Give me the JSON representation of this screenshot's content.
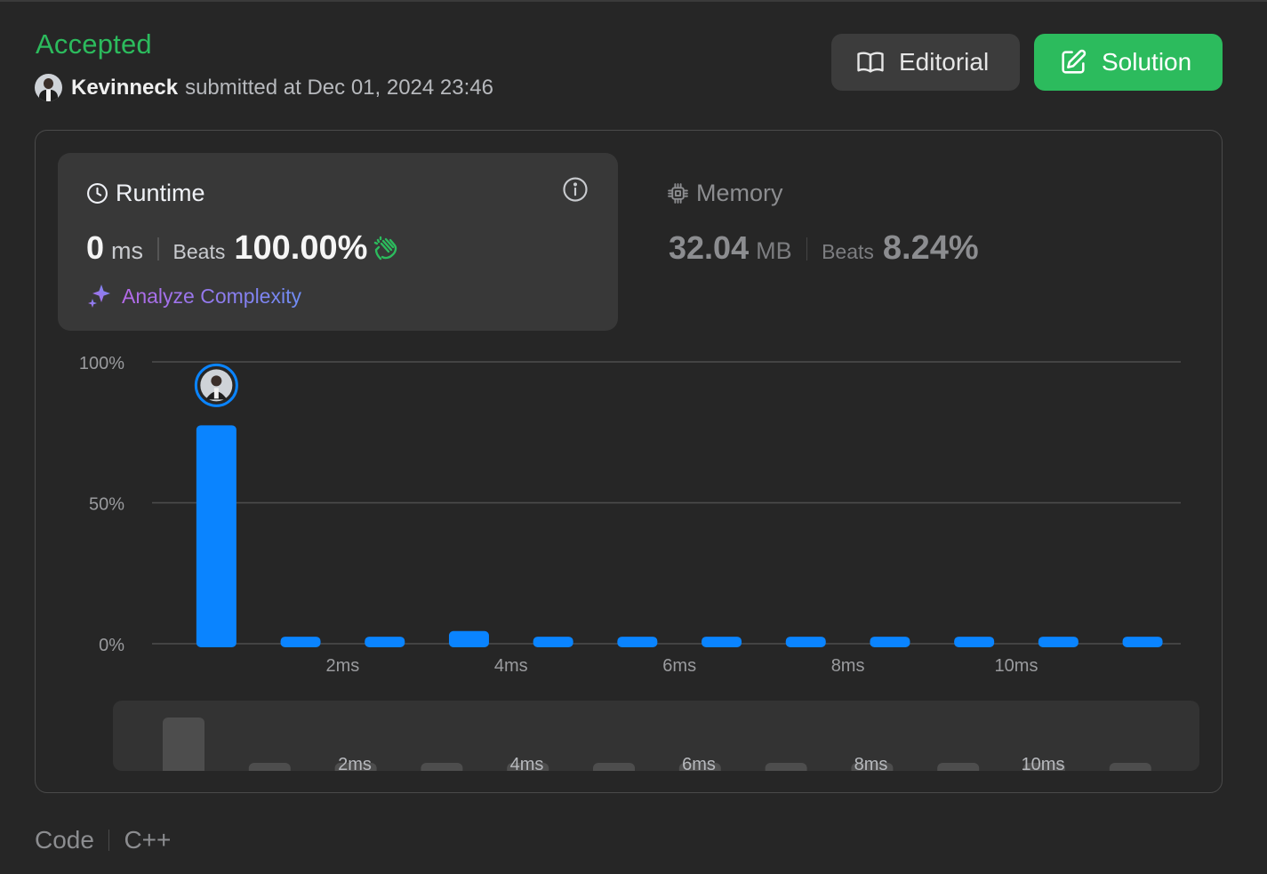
{
  "header": {
    "status": "Accepted",
    "username": "Kevinneck",
    "submitted_text": "submitted at Dec 01, 2024 23:46"
  },
  "buttons": {
    "editorial_label": "Editorial",
    "solution_label": "Solution"
  },
  "runtime": {
    "title": "Runtime",
    "value": "0",
    "unit": "ms",
    "beats_label": "Beats",
    "beats_pct": "100.00%",
    "analyze_label": "Analyze Complexity"
  },
  "memory": {
    "title": "Memory",
    "value": "32.04",
    "unit": "MB",
    "beats_label": "Beats",
    "beats_pct": "8.24%"
  },
  "footer": {
    "code_label": "Code",
    "language": "C++"
  },
  "colors": {
    "accent_green": "#2cbb5d",
    "bar_blue": "#0a84ff",
    "mini_bar_gray": "#4d4d4d"
  },
  "chart_data": {
    "type": "bar",
    "ylim": [
      0,
      100
    ],
    "y_ticks": [
      "100%",
      "50%",
      "0%"
    ],
    "x_tick_labels": [
      "2ms",
      "4ms",
      "6ms",
      "8ms",
      "10ms"
    ],
    "x_tick_positions": [
      2,
      4,
      6,
      8,
      10
    ],
    "bins": [
      0.5,
      1.5,
      2.5,
      3.5,
      4.5,
      5.5,
      6.5,
      7.5,
      8.5,
      9.5,
      10.5,
      11.5
    ],
    "values": [
      77.5,
      2.5,
      2.5,
      4.5,
      2.5,
      2.5,
      2.5,
      2.5,
      2.5,
      2.5,
      2.5,
      2.5
    ],
    "highlighted_bin_index": 0,
    "grid": true,
    "overview_bar_heights": [
      100,
      15,
      15,
      15,
      15,
      15,
      15,
      15,
      15,
      15,
      15,
      15
    ]
  }
}
